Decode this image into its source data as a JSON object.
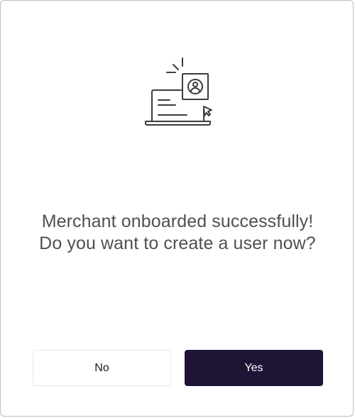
{
  "dialog": {
    "illustration_icon": "laptop-user-cursor-icon",
    "message": "Merchant onboarded successfully! Do you want to create a user now?",
    "buttons": {
      "no_label": "No",
      "yes_label": "Yes"
    }
  },
  "colors": {
    "primary_button": "#1f1435",
    "text": "#505050",
    "border": "#bdbdbd"
  }
}
